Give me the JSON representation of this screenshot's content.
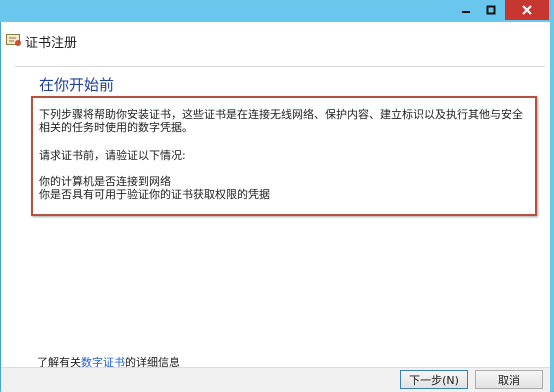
{
  "window": {
    "title": "证书注册",
    "controls": {
      "minimize_icon": "minimize-icon",
      "maximize_icon": "maximize-icon",
      "close_icon": "close-icon"
    }
  },
  "page": {
    "heading": "在你开始前",
    "intro": "下列步骤将帮助你安装证书，这些证书是在连接无线网络、保护内容、建立标识以及执行其他与安全相关的任务时使用的数字凭据。",
    "prompt": "请求证书前，请验证以下情况:",
    "checks": [
      "你的计算机是否连接到网络",
      "你是否具有可用于验证你的证书获取权限的凭据"
    ],
    "learn_more": {
      "prefix": "了解有关",
      "link": "数字证书",
      "suffix": "的详细信息"
    }
  },
  "footer": {
    "next_label": "下一步(N)",
    "cancel_label": "取消"
  },
  "colors": {
    "frame": "#69c6ec",
    "close": "#c7372f",
    "heading": "#1e3f9a",
    "link": "#1c5fd1",
    "highlight_border": "#b5523f"
  }
}
